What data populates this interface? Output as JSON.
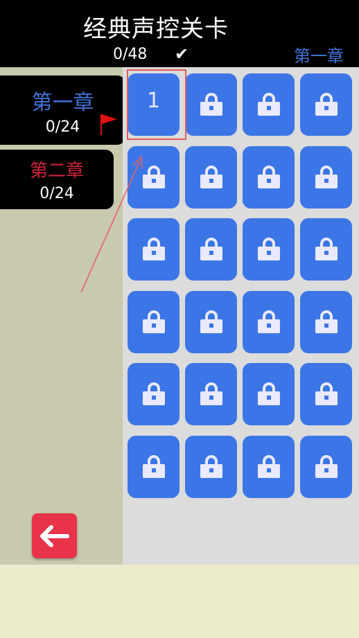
{
  "header": {
    "title": "经典声控关卡",
    "progress": "0/48",
    "check_icon": "checkmark-icon",
    "current_chapter": "第一章"
  },
  "sidebar": {
    "chapters": [
      {
        "name": "第一章",
        "count": "0/24",
        "color": "#3d73d8",
        "selected": true
      },
      {
        "name": "第二章",
        "count": "0/24",
        "color": "#d0233a",
        "selected": false
      }
    ],
    "flag_icon": "red-flag-icon",
    "back_icon": "arrow-left-icon"
  },
  "grid": {
    "columns": 4,
    "rows": 6,
    "levels": [
      {
        "label": "1",
        "locked": false
      },
      {
        "label": "",
        "locked": true
      },
      {
        "label": "",
        "locked": true
      },
      {
        "label": "",
        "locked": true
      },
      {
        "label": "",
        "locked": true
      },
      {
        "label": "",
        "locked": true
      },
      {
        "label": "",
        "locked": true
      },
      {
        "label": "",
        "locked": true
      },
      {
        "label": "",
        "locked": true
      },
      {
        "label": "",
        "locked": true
      },
      {
        "label": "",
        "locked": true
      },
      {
        "label": "",
        "locked": true
      },
      {
        "label": "",
        "locked": true
      },
      {
        "label": "",
        "locked": true
      },
      {
        "label": "",
        "locked": true
      },
      {
        "label": "",
        "locked": true
      },
      {
        "label": "",
        "locked": true
      },
      {
        "label": "",
        "locked": true
      },
      {
        "label": "",
        "locked": true
      },
      {
        "label": "",
        "locked": true
      },
      {
        "label": "",
        "locked": true
      },
      {
        "label": "",
        "locked": true
      },
      {
        "label": "",
        "locked": true
      },
      {
        "label": "",
        "locked": true
      }
    ],
    "tile_color": "#3c76e6",
    "lock_icon": "lock-icon"
  },
  "colors": {
    "header_bg": "#000000",
    "sidebar_bg": "#c8c9ad",
    "panel_bg": "#dcdcdc",
    "back_button": "#e8334a"
  }
}
